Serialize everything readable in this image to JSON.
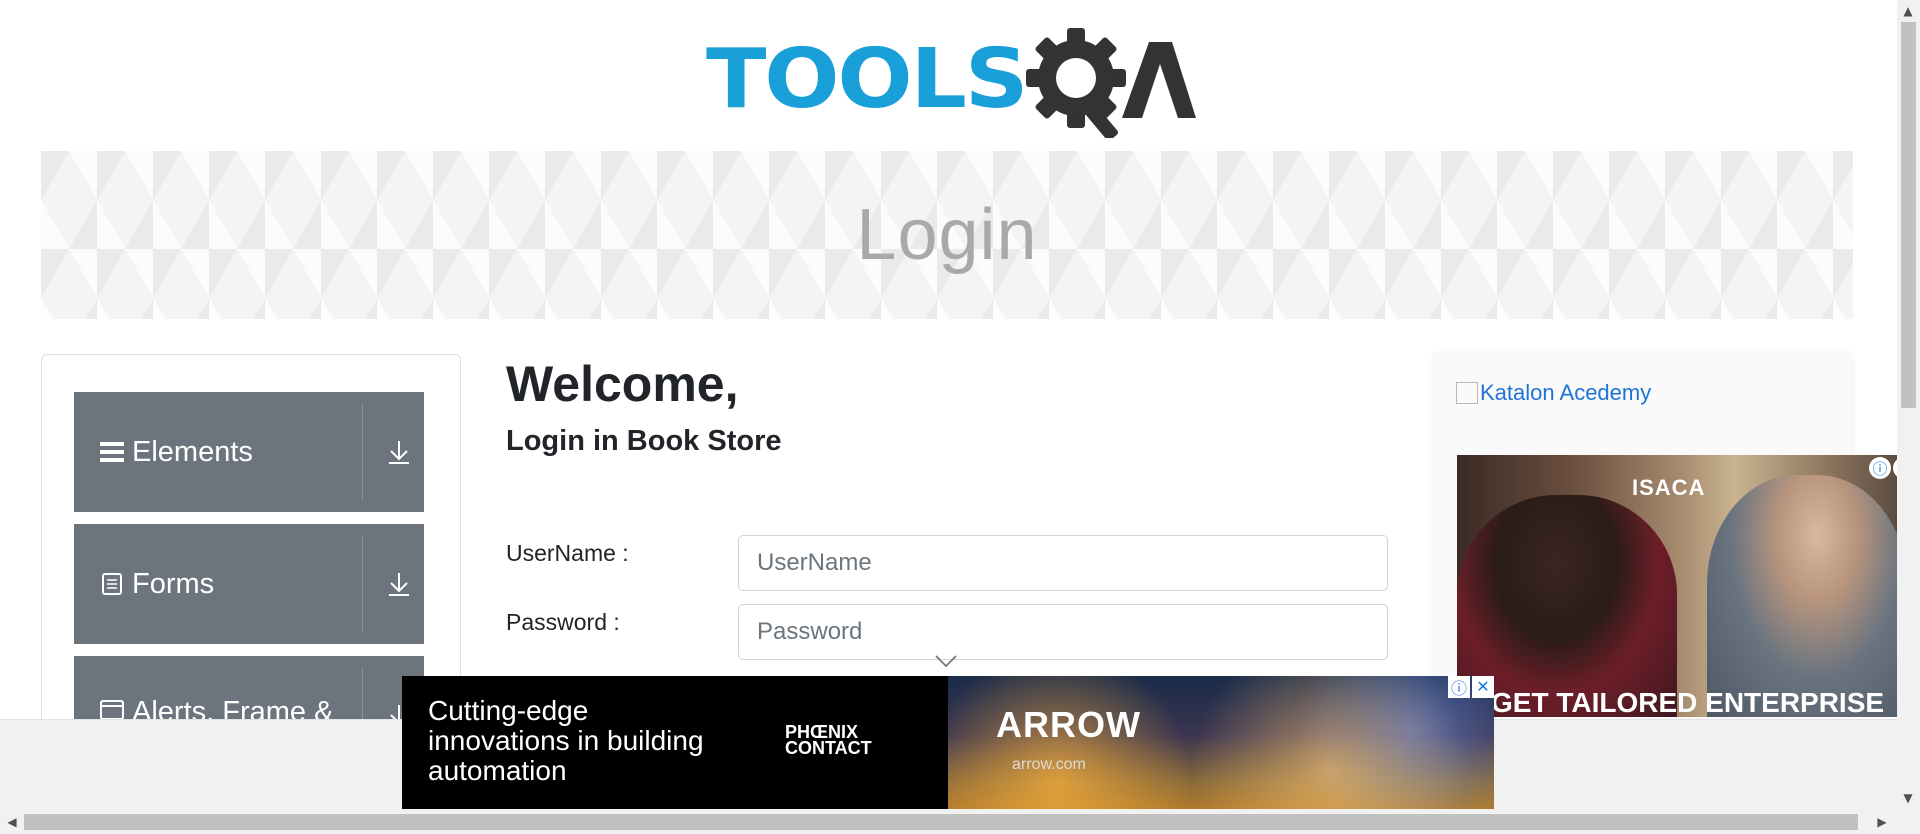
{
  "header": {
    "logo_text_left": "TOOLS",
    "logo_text_right": "QA"
  },
  "banner": {
    "title": "Login"
  },
  "sidebar": {
    "groups": [
      {
        "label": "Elements",
        "icon": "hamburger-icon"
      },
      {
        "label": "Forms",
        "icon": "document-icon"
      },
      {
        "label": "Alerts, Frame &",
        "icon": "window-icon"
      }
    ]
  },
  "main": {
    "welcome": "Welcome,",
    "subtitle": "Login in Book Store",
    "username_label": "UserName :",
    "username_placeholder": "UserName",
    "username_value": "",
    "password_label": "Password :",
    "password_placeholder": "Password",
    "password_value": ""
  },
  "right_ads": {
    "katalon_alt": "Katalon Acedemy",
    "isaca_brand": "ISACA",
    "isaca_tagline": "GET TAILORED ENTERPRISE"
  },
  "bottom_ad": {
    "text": "Cutting-edge\ninnovations in building\nautomation",
    "advertiser_line1": "PHŒNIX",
    "advertiser_line2": "CONTACT",
    "partner_brand": "ARROW",
    "partner_url": "arrow.com"
  },
  "colors": {
    "brand_blue": "#1aa0d8",
    "logo_dark": "#333333",
    "sidebar_group_bg": "#6c757d",
    "link_blue": "#1e73d8"
  }
}
